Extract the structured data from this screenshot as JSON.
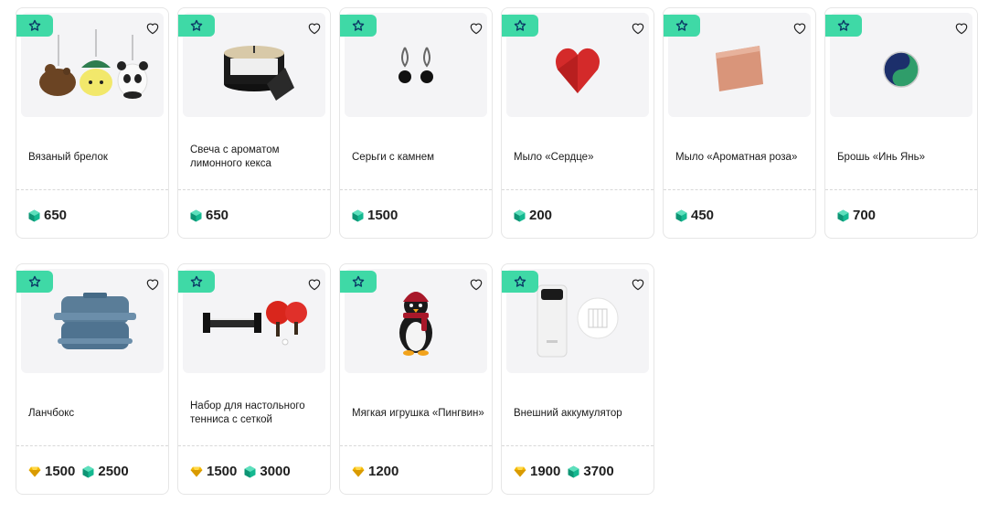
{
  "products": [
    {
      "title": "Вязаный брелок",
      "prices": [
        {
          "currency": "crystal-icon",
          "value": "650"
        }
      ]
    },
    {
      "title": "Свеча с ароматом лимонного кекса",
      "prices": [
        {
          "currency": "crystal-icon",
          "value": "650"
        }
      ]
    },
    {
      "title": "Серьги с камнем",
      "prices": [
        {
          "currency": "crystal-icon",
          "value": "1500"
        }
      ]
    },
    {
      "title": "Мыло «Сердце»",
      "prices": [
        {
          "currency": "crystal-icon",
          "value": "200"
        }
      ]
    },
    {
      "title": "Мыло «Ароматная роза»",
      "prices": [
        {
          "currency": "crystal-icon",
          "value": "450"
        }
      ]
    },
    {
      "title": "Брошь «Инь Янь»",
      "prices": [
        {
          "currency": "crystal-icon",
          "value": "700"
        }
      ]
    },
    {
      "title": "Ланчбокс",
      "prices": [
        {
          "currency": "diamond-icon",
          "value": "1500"
        },
        {
          "currency": "crystal-icon",
          "value": "2500"
        }
      ]
    },
    {
      "title": "Набор для настольного тенниса с сеткой",
      "prices": [
        {
          "currency": "diamond-icon",
          "value": "1500"
        },
        {
          "currency": "crystal-icon",
          "value": "3000"
        }
      ]
    },
    {
      "title": "Мягкая игрушка «Пингвин»",
      "prices": [
        {
          "currency": "diamond-icon",
          "value": "1200"
        }
      ]
    },
    {
      "title": "Внешний аккумулятор",
      "prices": [
        {
          "currency": "diamond-icon",
          "value": "1900"
        },
        {
          "currency": "crystal-icon",
          "value": "3700"
        }
      ]
    }
  ],
  "colors": {
    "badge": "#3fd9a6",
    "badge_star": "#0b3a66",
    "crystal": "#14b890",
    "diamond": "#f2b705",
    "card_border": "#e6e6e6",
    "image_bg": "#f4f4f6"
  }
}
